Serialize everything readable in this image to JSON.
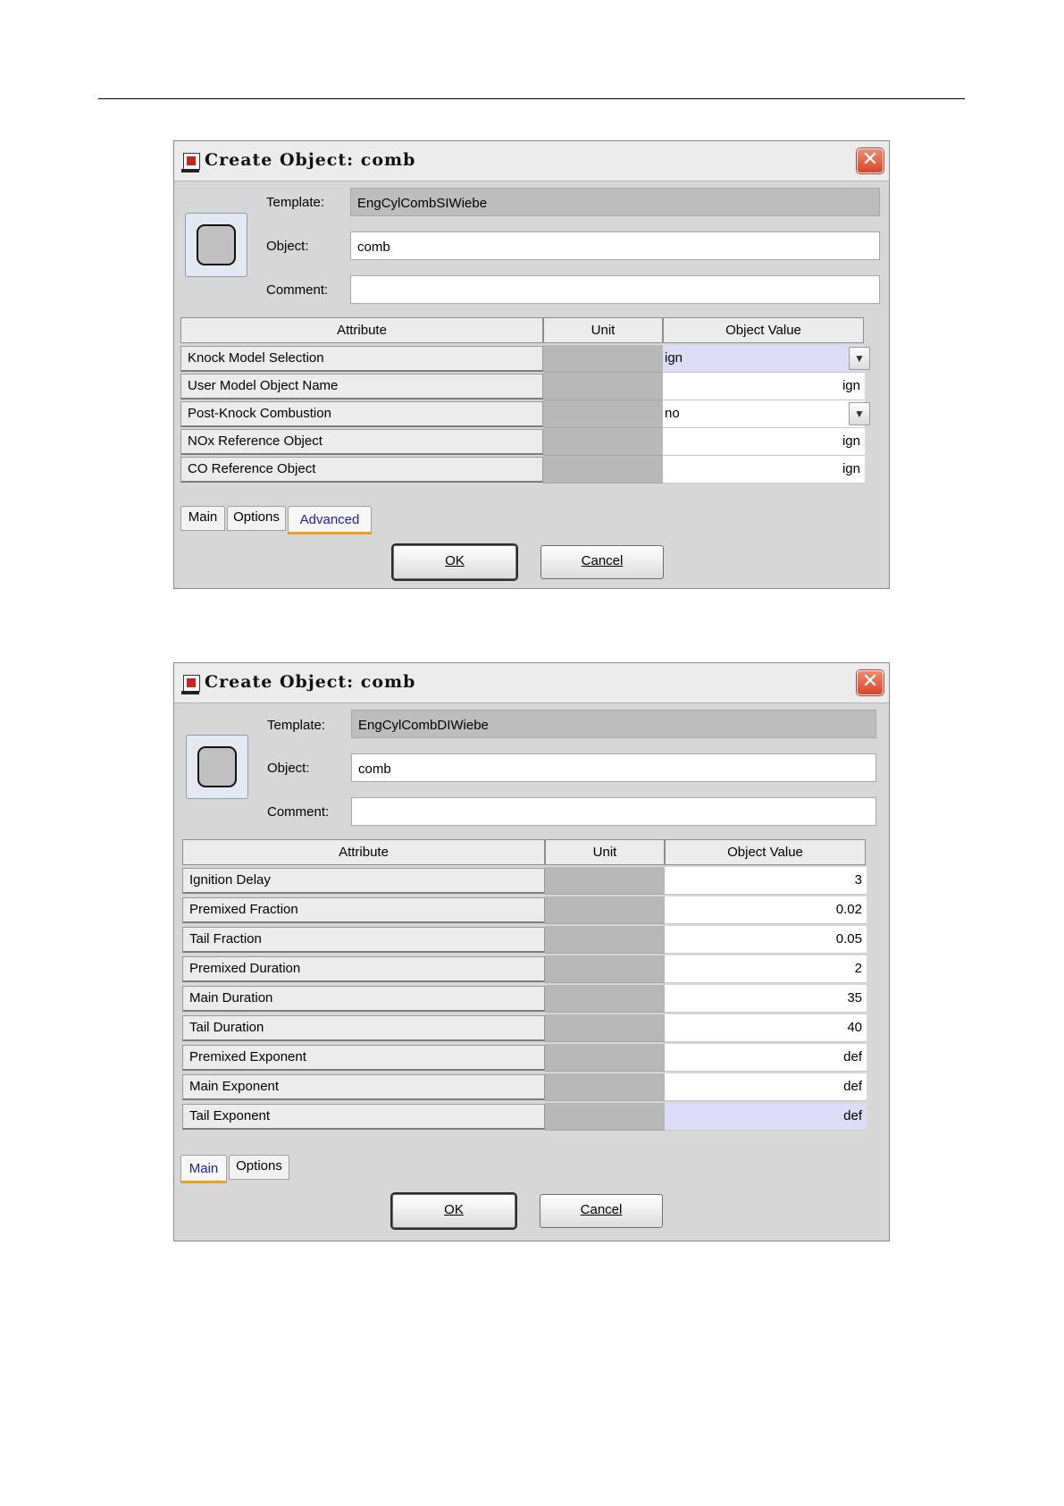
{
  "dialog1": {
    "title": "Create Object: comb",
    "template_label": "Template:",
    "template_value": "EngCylCombSIWiebe",
    "object_label": "Object:",
    "object_value": "comb",
    "comment_label": "Comment:",
    "comment_value": "",
    "columns": [
      "Attribute",
      "Unit",
      "Object Value"
    ],
    "rows": [
      {
        "attribute": "Knock Model Selection",
        "unit": "",
        "value": "ign",
        "type": "dropdown"
      },
      {
        "attribute": "User Model Object Name",
        "unit": "",
        "value": "ign",
        "type": "text"
      },
      {
        "attribute": "Post-Knock Combustion",
        "unit": "",
        "value": "no",
        "type": "dropdown"
      },
      {
        "attribute": "NOx Reference Object",
        "unit": "",
        "value": "ign",
        "type": "text"
      },
      {
        "attribute": "CO Reference Object",
        "unit": "",
        "value": "ign",
        "type": "text"
      }
    ],
    "tabs": [
      "Main",
      "Options",
      "Advanced"
    ],
    "active_tab": "Advanced",
    "ok_label": "OK",
    "cancel_label": "Cancel"
  },
  "dialog2": {
    "title": "Create Object: comb",
    "template_label": "Template:",
    "template_value": "EngCylCombDIWiebe",
    "object_label": "Object:",
    "object_value": "comb",
    "comment_label": "Comment:",
    "comment_value": "",
    "columns": [
      "Attribute",
      "Unit",
      "Object Value"
    ],
    "rows": [
      {
        "attribute": "Ignition Delay",
        "unit": "",
        "value": "3"
      },
      {
        "attribute": "Premixed Fraction",
        "unit": "",
        "value": "0.02"
      },
      {
        "attribute": "Tail Fraction",
        "unit": "",
        "value": "0.05"
      },
      {
        "attribute": "Premixed Duration",
        "unit": "",
        "value": "2"
      },
      {
        "attribute": "Main Duration",
        "unit": "",
        "value": "35"
      },
      {
        "attribute": "Tail Duration",
        "unit": "",
        "value": "40"
      },
      {
        "attribute": "Premixed Exponent",
        "unit": "",
        "value": "def"
      },
      {
        "attribute": "Main Exponent",
        "unit": "",
        "value": "def"
      },
      {
        "attribute": "Tail Exponent",
        "unit": "",
        "value": "def"
      }
    ],
    "tabs": [
      "Main",
      "Options"
    ],
    "active_tab": "Main",
    "ok_label": "OK",
    "cancel_label": "Cancel"
  },
  "icons": {
    "app": "app-window-icon",
    "close": "close-icon",
    "object": "object-shape-icon",
    "dropdown": "chevron-down-icon"
  },
  "colors": {
    "tab_active_text": "#1a22a8",
    "tab_active_underline": "#f0a020",
    "selected_cell": "#dcdcf6",
    "close_button": "#d8452a"
  }
}
